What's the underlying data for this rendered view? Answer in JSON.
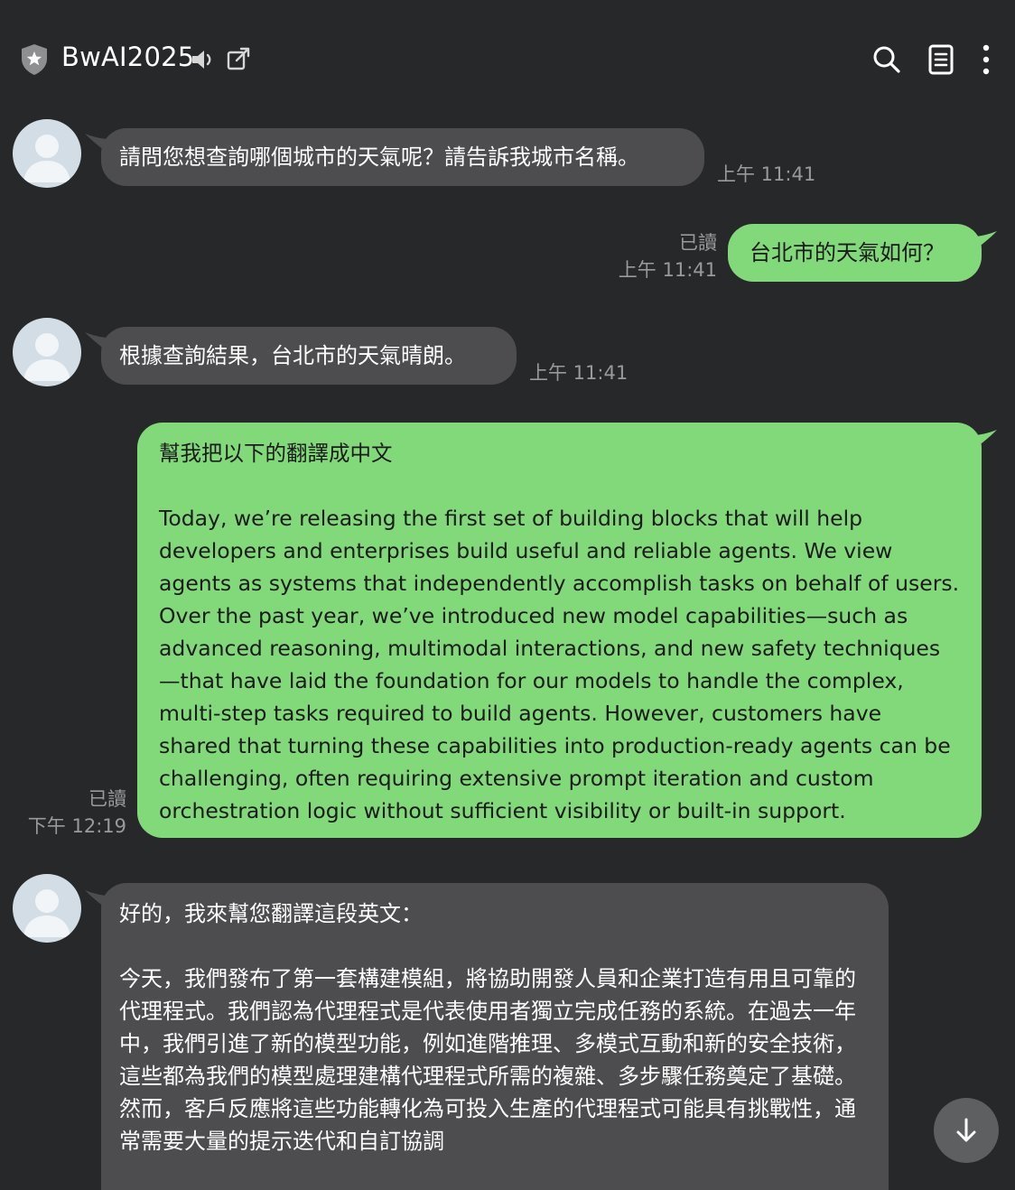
{
  "header": {
    "title": "BwAI2025",
    "icons": [
      "shield-star-icon",
      "speaker-icon",
      "external-link-icon",
      "search-icon",
      "notes-icon",
      "more-vertical-icon"
    ]
  },
  "colors": {
    "background": "#27282a",
    "incoming_bubble": "#4d4d4f",
    "outgoing_bubble": "#82d97a",
    "meta_text": "#9a9a9c"
  },
  "messages": [
    {
      "direction": "in",
      "text": "請問您想查詢哪個城市的天氣呢？請告訴我城市名稱。",
      "time": "上午 11:41"
    },
    {
      "direction": "out",
      "text": "台北市的天氣如何？",
      "read": "已讀",
      "time": "上午 11:41"
    },
    {
      "direction": "in",
      "text": "根據查詢結果，台北市的天氣晴朗。",
      "time": "上午 11:41"
    },
    {
      "direction": "out",
      "text": "幫我把以下的翻譯成中文\n\nToday, we’re releasing the first set of building blocks that will help developers and enterprises build useful and reliable agents. We view agents as systems that independently accomplish tasks on behalf of users. Over the past year, we’ve introduced new model capabilities—such as advanced reasoning, multimodal interactions, and new safety techniques—that have laid the foundation for our models to handle the complex, multi-step tasks required to build agents. However, customers have shared that turning these capabilities into production-ready agents can be challenging, often requiring extensive prompt iteration and custom orchestration logic without sufficient visibility or built-in support.",
      "read": "已讀",
      "time": "下午 12:19"
    },
    {
      "direction": "in",
      "text": "好的，我來幫您翻譯這段英文：\n\n今天，我們發布了第一套構建模組，將協助開發人員和企業打造有用且可靠的代理程式。我們認為代理程式是代表使用者獨立完成任務的系統。在過去一年中，我們引進了新的模型功能，例如進階推理、多模式互動和新的安全技術，這些都為我們的模型處理建構代理程式所需的複雜、多步驟任務奠定了基礎。然而，客戶反應將這些功能轉化為可投入生產的代理程式可能具有挑戰性，通常需要大量的提示迭代和自訂協調"
    }
  ]
}
